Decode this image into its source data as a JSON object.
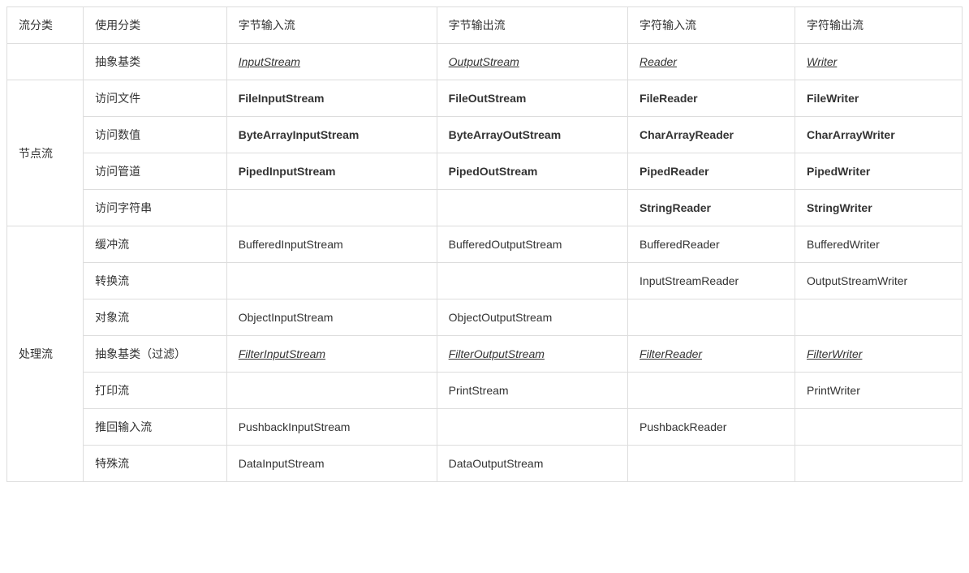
{
  "chart_data": {
    "type": "table",
    "header": [
      "流分类",
      "使用分类",
      "字节输入流",
      "字节输出流",
      "字符输入流",
      "字符输出流"
    ],
    "rows": [
      {
        "category": "",
        "usage": "抽象基类",
        "style": "italic-underline",
        "cells": [
          "InputStream",
          "OutputStream",
          "Reader",
          "Writer"
        ]
      },
      {
        "category": "节点流",
        "rowspan": 4,
        "usage": "访问文件",
        "style": "bold",
        "cells": [
          "FileInputStream",
          "FileOutStream",
          "FileReader",
          "FileWriter"
        ]
      },
      {
        "usage": "访问数值",
        "style": "bold",
        "cells": [
          "ByteArrayInputStream",
          "ByteArrayOutStream",
          "CharArrayReader",
          "CharArrayWriter"
        ]
      },
      {
        "usage": "访问管道",
        "style": "bold",
        "cells": [
          "PipedInputStream",
          "PipedOutStream",
          "PipedReader",
          "PipedWriter"
        ]
      },
      {
        "usage": "访问字符串",
        "style": "bold",
        "cells": [
          "",
          "",
          "StringReader",
          "StringWriter"
        ]
      },
      {
        "category": "处理流",
        "rowspan": 7,
        "usage": "缓冲流",
        "style": "",
        "cells": [
          "BufferedInputStream",
          "BufferedOutputStream",
          "BufferedReader",
          "BufferedWriter"
        ]
      },
      {
        "usage": "转换流",
        "style": "",
        "cells": [
          "",
          "",
          "InputStreamReader",
          "OutputStreamWriter"
        ]
      },
      {
        "usage": "对象流",
        "style": "",
        "cells": [
          "ObjectInputStream",
          "ObjectOutputStream",
          "",
          ""
        ]
      },
      {
        "usage": "抽象基类（过滤）",
        "style": "italic-underline",
        "cells": [
          "FilterInputStream",
          "FilterOutputStream",
          "FilterReader",
          "FilterWriter"
        ]
      },
      {
        "usage": "打印流",
        "style": "",
        "cells": [
          "",
          "PrintStream",
          "",
          "PrintWriter"
        ]
      },
      {
        "usage": "推回输入流",
        "style": "",
        "cells": [
          "PushbackInputStream",
          "",
          "PushbackReader",
          ""
        ]
      },
      {
        "usage": "特殊流",
        "style": "",
        "cells": [
          "DataInputStream",
          "DataOutputStream",
          "",
          ""
        ]
      }
    ]
  }
}
